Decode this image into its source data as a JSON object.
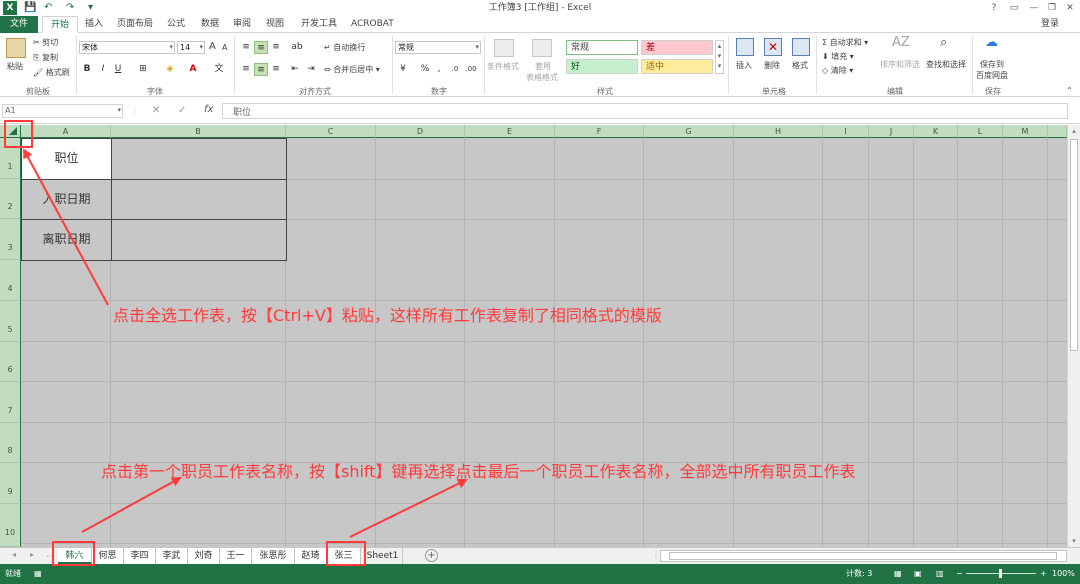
{
  "app": {
    "title": "工作簿3 [工作组] - Excel",
    "login": "登录",
    "window_buttons": [
      "?",
      "▭",
      "—",
      "❐",
      "✕"
    ]
  },
  "tabs": [
    "文件",
    "开始",
    "插入",
    "页面布局",
    "公式",
    "数据",
    "审阅",
    "视图",
    "开发工具",
    "ACROBAT"
  ],
  "ribbon": {
    "clipboard": {
      "paste": "粘贴",
      "cut": "剪切",
      "copy": "复制",
      "format_painter": "格式刷",
      "label": "剪贴板"
    },
    "font": {
      "name": "宋体",
      "size": "14",
      "label": "字体",
      "bold": "B",
      "italic": "I",
      "underline": "U",
      "grow": "A",
      "shrink": "A"
    },
    "alignment": {
      "wrap": "自动换行",
      "merge": "合并后居中",
      "label": "对齐方式"
    },
    "number": {
      "format": "常规",
      "percent": "%",
      "comma": ",",
      "label": "数字"
    },
    "styles": {
      "conditional": "条件格式",
      "table_format_1": "套用",
      "table_format_2": "表格格式",
      "normal": "常规",
      "bad": "差",
      "good": "好",
      "neutral": "适中",
      "label": "样式"
    },
    "cells": {
      "insert": "插入",
      "delete": "删除",
      "format": "格式",
      "label": "单元格"
    },
    "editing": {
      "autosum": "自动求和",
      "fill": "填充",
      "clear": "清除",
      "sort": "排序和筛选",
      "find": "查找和选择",
      "label": "编辑"
    },
    "save": {
      "line1": "保存到",
      "line2": "百度网盘",
      "label": "保存"
    }
  },
  "formula_bar": {
    "name_box": "A1",
    "cancel": "✕",
    "enter": "✓",
    "fx": "fx",
    "value": "职位"
  },
  "grid": {
    "columns": [
      "A",
      "B",
      "C",
      "D",
      "E",
      "F",
      "G",
      "H",
      "I",
      "J",
      "K",
      "L",
      "M"
    ],
    "rows": [
      "1",
      "2",
      "3",
      "4",
      "5",
      "6",
      "7",
      "8",
      "9",
      "10"
    ],
    "cells": {
      "A1": "职位",
      "A2": "入职日期",
      "A3": "离职日期"
    }
  },
  "sheets": [
    "韩六",
    "何思",
    "李四",
    "李武",
    "刘奇",
    "王一",
    "张思彤",
    "赵琦",
    "张三",
    "Sheet1"
  ],
  "status": {
    "ready": "就绪",
    "count": "计数: 3",
    "zoom": "100%"
  },
  "annotations": {
    "top": "点击全选工作表，按【Ctrl+V】粘贴，这样所有工作表复制了相同格式的模版",
    "bottom": "点击第一个职员工作表名称，按【shift】键再选择点击最后一个职员工作表名称，全部选中所有职员工作表"
  },
  "colors": {
    "accent": "#217346",
    "annotation": "#ff3b3b",
    "grid_selected": "#c7c7c7"
  }
}
